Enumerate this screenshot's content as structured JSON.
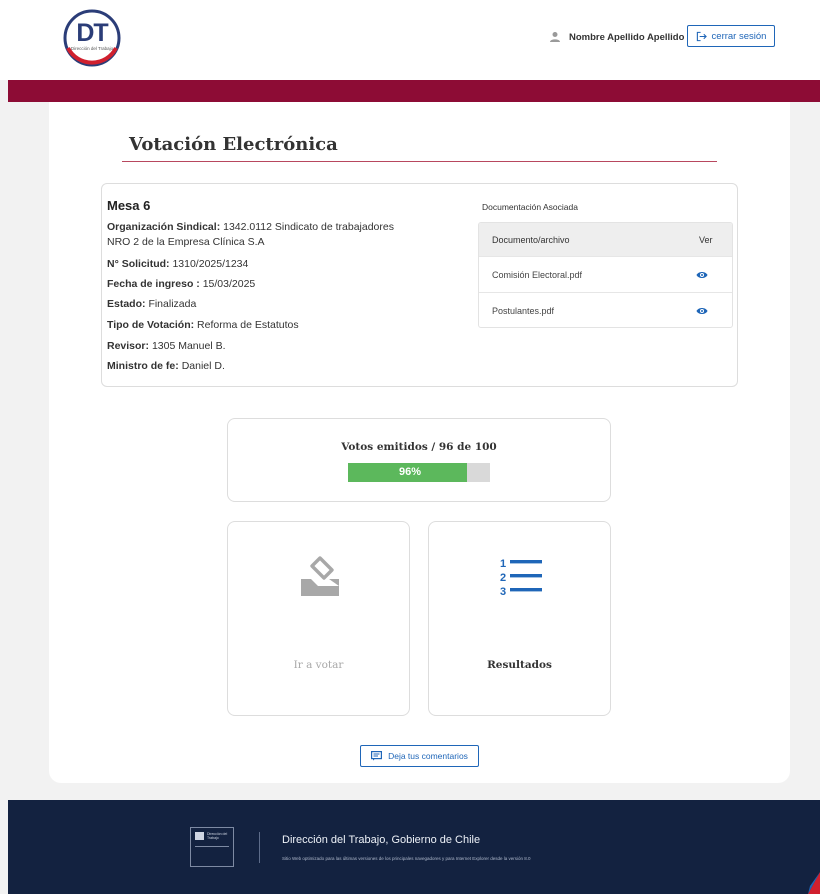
{
  "header": {
    "logo_letters": "DT",
    "logo_subtitle": "Dirección del Trabajo",
    "user_name": "Nombre Apellido Apellido",
    "logout_label": "cerrar sesión"
  },
  "page_title": "Votación Electrónica",
  "mesa": {
    "title": "Mesa 6",
    "org_label": "Organización Sindical:",
    "org_value_line1": "1342.0112 Sindicato de trabajadores",
    "org_value_line2": "NRO 2 de la Empresa Clínica S.A",
    "solicitud_label": "N° Solicitud:",
    "solicitud_value": "1310/2025/1234",
    "fecha_label": "Fecha de ingreso :",
    "fecha_value": "15/03/2025",
    "estado_label": "Estado:",
    "estado_value": "Finalizada",
    "tipo_label": "Tipo de Votación:",
    "tipo_value": "Reforma de Estatutos",
    "revisor_label": "Revisor:",
    "revisor_value": "1305 Manuel B.",
    "ministro_label": "Ministro de fe:",
    "ministro_value": "Daniel D."
  },
  "documents": {
    "section_title": "Documentación Asociada",
    "col_name": "Documento/archivo",
    "col_view": "Ver",
    "rows": [
      {
        "name": "Comisión Electoral.pdf"
      },
      {
        "name": "Postulantes.pdf"
      }
    ]
  },
  "votes": {
    "title": "Votos emitidos / 96 de 100",
    "progress_percent": 96,
    "progress_label": "96%"
  },
  "tiles": {
    "vote_label": "Ir a votar",
    "results_label": "Resultados"
  },
  "comment_label": "Deja tus comentarios",
  "footer": {
    "logo_text": "Dirección del Trabajo",
    "title": "Dirección del Trabajo, Gobierno de Chile",
    "subtitle": "Sitio Web optimizado para las últimas versiones de los principales navegadores y para Internet Explorer desde la versión 8.0"
  },
  "colors": {
    "brand_red": "#8d0c35",
    "brand_blue": "#1f66b8",
    "footer_navy": "#132240",
    "progress_green": "#5cb85c"
  }
}
